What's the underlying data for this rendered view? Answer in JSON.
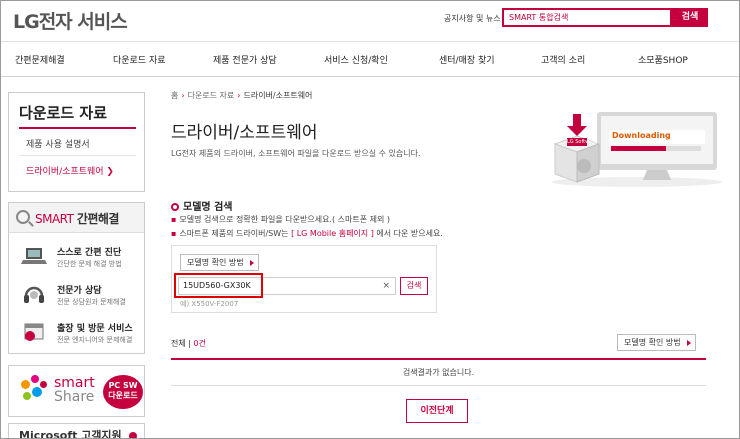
{
  "header": {
    "logo_lg": "LG",
    "logo_brand": "전자 서비스",
    "notice": "공지사항 및 뉴스",
    "search_placeholder": "SMART 통합검색",
    "search_button": "검색"
  },
  "gnb": [
    "간편문제해결",
    "다운로드 자료",
    "제품 전문가 상담",
    "서비스 신청/확인",
    "센터/매장 찾기",
    "고객의 소리",
    "소모품SHOP"
  ],
  "lnb": {
    "title": "다운로드 자료",
    "items": [
      "제품 사용 설명서",
      "드라이버/소프트웨어 ❯"
    ]
  },
  "smart_solve": {
    "title_red": "SMART",
    "title_dark": "간편해결",
    "rows": [
      {
        "title": "스스로 간편 진단",
        "sub": "간단한 문제 해결 방법"
      },
      {
        "title": "전문가 상담",
        "sub": "전문 상담원과 문제해결"
      },
      {
        "title": "출장 및 방문 서비스",
        "sub": "전문 엔지니어와 문제해결"
      }
    ]
  },
  "smartshare": {
    "smart": "smart",
    "share": "Share",
    "badge_line1": "PC SW",
    "badge_line2": "다운로드"
  },
  "microsoft": "Microsoft 고객지원",
  "breadcrumb": {
    "home": "홈",
    "mid": "다운로드 자료",
    "current": "드라이버/소프트웨어"
  },
  "page": {
    "title": "드라이버/소프트웨어",
    "desc": "LG전자 제품의 드라이버, 소프트웨어 파일을 다운로드 받으실 수 있습니다."
  },
  "illustration": {
    "label": "Downloading",
    "box_label": "LG Software"
  },
  "model_search": {
    "title": "모델명 검색",
    "bullet1": "모델명 검색으로 정확한 파일을 다운받으세요.( 스마트폰 제외 )",
    "bullet2_pre": "스마트폰 제품의 드라이버/SW는",
    "bullet2_link": "[ LG Mobile 홈페이지 ]",
    "bullet2_post": "에서 다운 받으세요.",
    "how_button": "모델명 확인 방법",
    "input_value": "15UD560-GX30K",
    "clear": "×",
    "search_button": "검색",
    "example": "예) X550V-F2007"
  },
  "results": {
    "label": "전체",
    "count": "0건",
    "how_button": "모델명 확인 방법",
    "empty": "검색결과가 없습니다.",
    "prev_button": "이전단계"
  }
}
